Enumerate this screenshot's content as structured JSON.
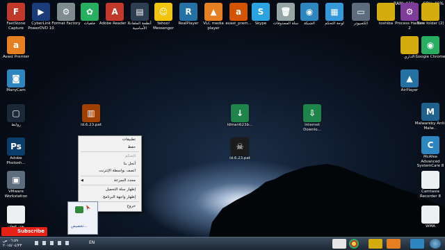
{
  "sysmon": {
    "ram": "RAM: 41%",
    "cpu": "CPU: 46%"
  },
  "icons": [
    {
      "label": "FastStone Capture",
      "name": "faststone-capture-icon",
      "color": "#c0392b",
      "glyph": "F"
    },
    {
      "label": "CyberLink PowerDVD 10",
      "name": "powerdvd-icon",
      "color": "#1a3c78",
      "glyph": "▶"
    },
    {
      "label": "Format Factory",
      "name": "format-factory-icon",
      "color": "#7f8c8d",
      "glyph": "⚙"
    },
    {
      "label": "خلفيات",
      "name": "wallpapers-icon",
      "color": "#27ae60",
      "glyph": "✿"
    },
    {
      "label": "Adobe Reader X",
      "name": "adobe-reader-icon",
      "color": "#c0392b",
      "glyph": "A"
    },
    {
      "label": "أنظمة الملفات الأساسية",
      "name": "book-icon",
      "color": "#2c3e50",
      "glyph": "▤"
    },
    {
      "label": "Yahoo! Messenger",
      "name": "yahoo-messenger-icon",
      "color": "#f1c40f",
      "glyph": "☺"
    },
    {
      "label": "RealPlayer",
      "name": "realplayer-icon",
      "color": "#2471a3",
      "glyph": "R"
    },
    {
      "label": "VLC media player",
      "name": "vlc-icon",
      "color": "#e67e22",
      "glyph": "▲"
    },
    {
      "label": "avast_prem...",
      "name": "avast-icon",
      "color": "#d35400",
      "glyph": "a"
    },
    {
      "label": "Skype",
      "name": "skype-icon",
      "color": "#2aa3e0",
      "glyph": "S"
    },
    {
      "label": "سلة المحذوفات",
      "name": "recycle-bin-icon",
      "color": "#95a5a6",
      "glyph": "🗑"
    },
    {
      "label": "الشبكة",
      "name": "network-icon",
      "color": "#2e86c1",
      "glyph": "◉"
    },
    {
      "label": "لوحة التحكم",
      "name": "control-panel-icon",
      "color": "#3498db",
      "glyph": "▦"
    },
    {
      "label": "الكمبيوتر",
      "name": "computer-icon",
      "color": "#5d6d7e",
      "glyph": "▭"
    },
    {
      "label": "toshiba",
      "name": "folder-toshiba-icon",
      "color": "#d4ac0d",
      "glyph": ""
    },
    {
      "label": "Process Hacker 2",
      "name": "process-hacker-icon",
      "color": "#7d3c98",
      "glyph": "⚙"
    },
    {
      "label": "New folder (2)",
      "name": "folder-icon",
      "color": "#d4ac0d",
      "glyph": ""
    },
    {
      "label": "Avast Premier",
      "name": "avast-premier-icon",
      "color": "#e67e22",
      "glyph": "a"
    },
    {
      "label": "ManyCam",
      "name": "manycam-icon",
      "color": "#2e86c1",
      "glyph": "◙"
    },
    {
      "label": "روابط",
      "name": "links-file-icon",
      "color": "#1b2838",
      "glyph": "▢"
    },
    {
      "label": "Adobe Photosh...",
      "name": "photoshop-icon",
      "color": "#0b3d6b",
      "glyph": "Ps"
    },
    {
      "label": "VMware Workstation",
      "name": "vmware-icon",
      "color": "#5d6d7e",
      "glyph": "▣"
    },
    {
      "label": "يدن عنوان",
      "name": "wma-file-icon",
      "color": "#ecf0f1",
      "glyph": ""
    },
    {
      "label": "id.6.23.pat",
      "name": "archive-icon",
      "color": "#a04000",
      "glyph": "▥"
    },
    {
      "label": "idman623b...",
      "name": "idm-installer-icon",
      "color": "#1e8449",
      "glyph": "↓"
    },
    {
      "label": "id.6.23.pat",
      "name": "skull-file-icon",
      "color": "#1c1c1c",
      "glyph": "☠"
    },
    {
      "label": "Internet Downlo...",
      "name": "idm-icon",
      "color": "#1e8449",
      "glyph": "⇩"
    },
    {
      "label": "الاداري",
      "name": "folder-admin-icon",
      "color": "#d4ac0d",
      "glyph": ""
    },
    {
      "label": "Google Chrome",
      "name": "chrome-icon",
      "color": "#27ae60",
      "glyph": "◉"
    },
    {
      "label": "AirPlayer",
      "name": "airplayer-icon",
      "color": "#2471a3",
      "glyph": "▲"
    },
    {
      "label": "Malwareby Anti-Malw...",
      "name": "malwarebytes-icon",
      "color": "#1f618d",
      "glyph": "M"
    },
    {
      "label": "McAfee Advanced SystemCare 8",
      "name": "systemcare-icon",
      "color": "#2e86c1",
      "glyph": "C"
    },
    {
      "label": "Camtasia Recorder 8",
      "name": "camtasia-icon",
      "color": "#ecf0f1",
      "glyph": ""
    },
    {
      "label": "WMA",
      "name": "wma-right-icon",
      "color": "#ecf0f1",
      "glyph": ""
    }
  ],
  "context_menu": {
    "items": [
      {
        "label": "تطبيقات",
        "disabled": false,
        "arrow": false
      },
      {
        "label": "حفظ",
        "disabled": false,
        "arrow": false
      },
      {
        "label": "التحكم",
        "disabled": true,
        "arrow": false
      },
      {
        "label": "أنجل بنا",
        "disabled": false,
        "arrow": false
      },
      {
        "label": "اتصف بواسطة الإنترنت",
        "disabled": false,
        "arrow": false
      },
      {
        "label": "محدد السرعة",
        "disabled": false,
        "arrow": true
      },
      {
        "label": "إظهار سلة التحميل",
        "disabled": false,
        "arrow": false
      },
      {
        "label": "إظهار واجهة البرنامج",
        "disabled": false,
        "arrow": false
      },
      {
        "label": "خروج",
        "disabled": false,
        "arrow": false
      }
    ]
  },
  "tray_popup": {
    "label": "تخصيص..."
  },
  "subscribe": {
    "label": "Subscribe"
  },
  "taskbar": {
    "lang": "EN",
    "clock_time": "٠٦:٥٩ ص",
    "clock_date": "٢٠١٥/٠٤/٢٣"
  }
}
